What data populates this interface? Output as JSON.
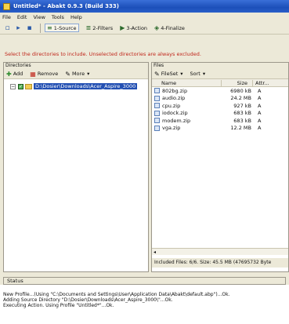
{
  "window": {
    "title": "Untitled* - Abakt 0.9.3 (Build 333)"
  },
  "menu": [
    "File",
    "Edit",
    "View",
    "Tools",
    "Help"
  ],
  "toolbar": {
    "steps": [
      {
        "label": "1-Source",
        "icon": "source-icon"
      },
      {
        "label": "2-Filters",
        "icon": "filters-icon"
      },
      {
        "label": "3-Action",
        "icon": "action-icon"
      },
      {
        "label": "4-Finalize",
        "icon": "finalize-icon"
      }
    ]
  },
  "hint": "Select the directories to include. Unselected directories are always excluded.",
  "directories": {
    "title": "Directories",
    "add_label": "Add",
    "remove_label": "Remove",
    "more_label": "More",
    "tree_item": "D:\\Dosier\\Downloads\\Acer_Aspire_3000"
  },
  "files": {
    "title": "Files",
    "fileset_label": "FileSet",
    "sort_label": "Sort",
    "columns": {
      "name": "Name",
      "size": "Size",
      "attr": "Attr..."
    },
    "rows": [
      {
        "name": "802bg.zip",
        "size": "6980 kB",
        "attr": "A"
      },
      {
        "name": "audio.zip",
        "size": "24.2 MB",
        "attr": "A"
      },
      {
        "name": "cpu.zip",
        "size": "927 kB",
        "attr": "A"
      },
      {
        "name": "iodock.zip",
        "size": "683 kB",
        "attr": "A"
      },
      {
        "name": "modem.zip",
        "size": "683 kB",
        "attr": "A"
      },
      {
        "name": "vga.zip",
        "size": "12.2 MB",
        "attr": "A"
      }
    ],
    "summary": "Included Files: 6/6. Size: 45.5 MB (47695732 Byte"
  },
  "status": {
    "title": "Status",
    "lines": [
      "New Profile...(Using \"C:\\Documents and Settings\\User\\Application Data\\Abakt\\default.abp\")...Ok.",
      "Adding Source Directory \"D:\\Dosier\\Downloads\\Acer_Aspire_3000\\\"...Ok.",
      "Executing Action. Using Profile \"Untitled*\"...Ok."
    ]
  }
}
